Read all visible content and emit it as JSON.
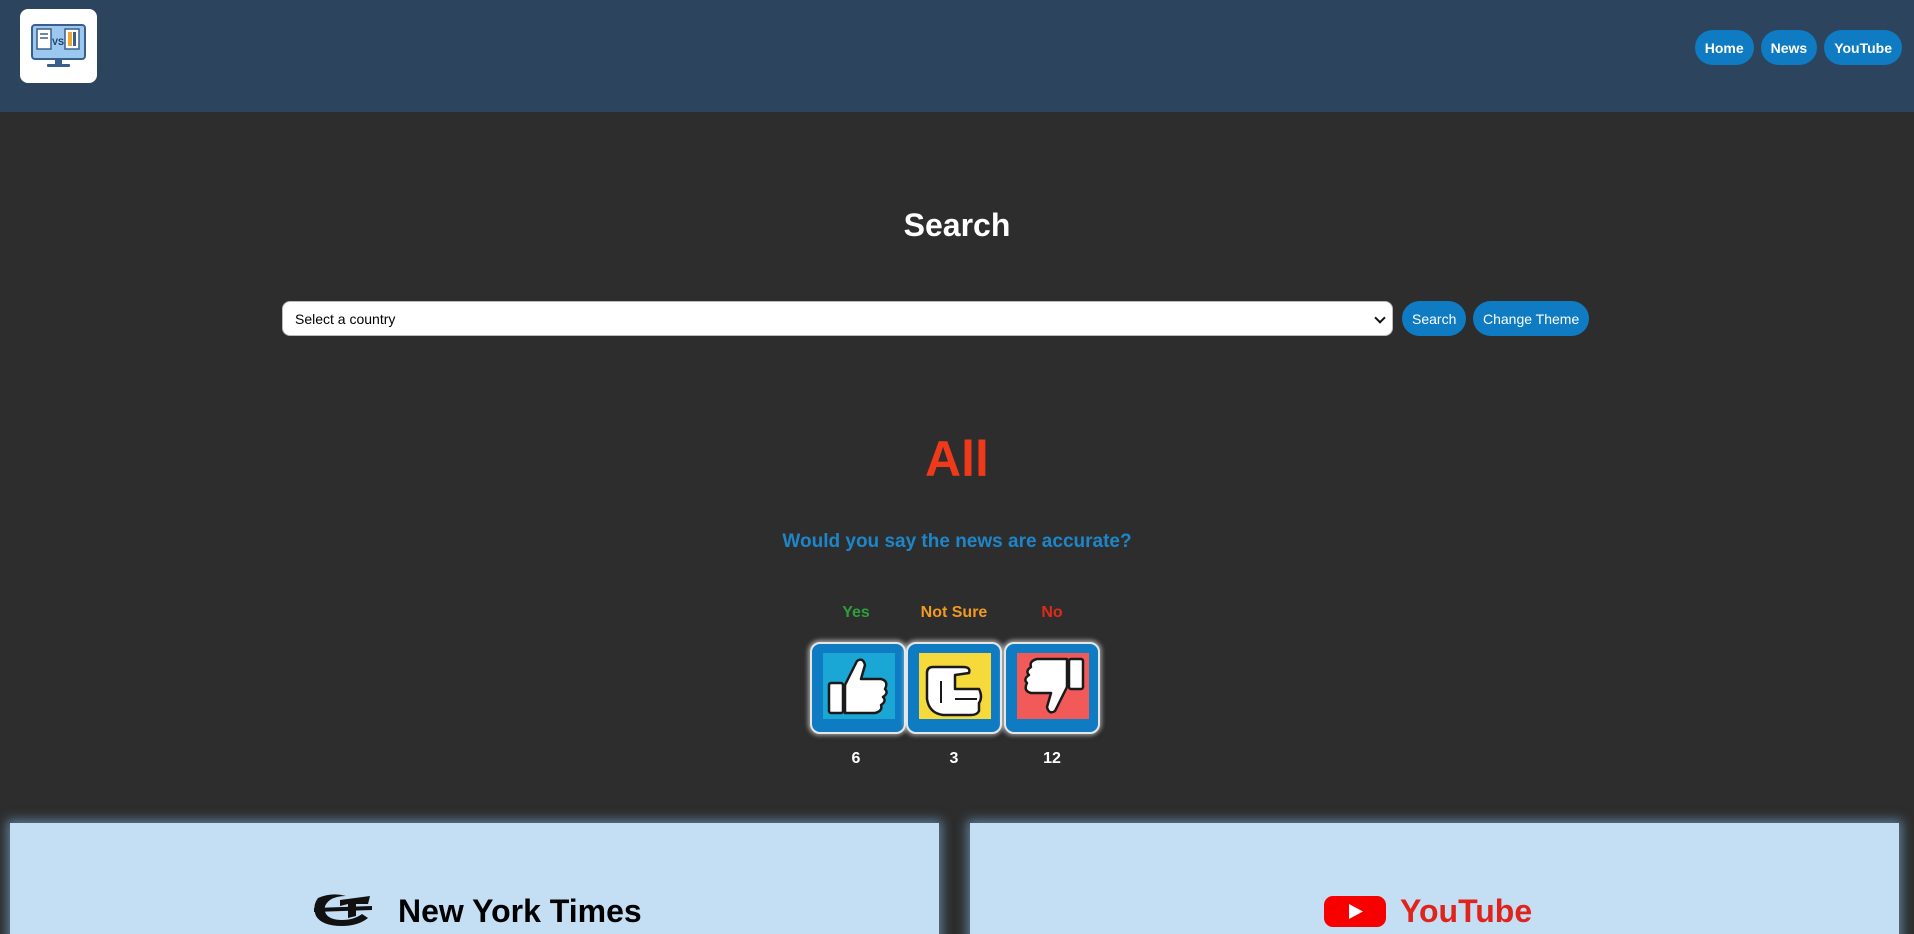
{
  "header": {
    "logo_icon": "monitor-versus-icon",
    "logo_text": "VS",
    "nav": [
      {
        "label": "Home"
      },
      {
        "label": "News"
      },
      {
        "label": "YouTube"
      }
    ]
  },
  "search": {
    "title": "Search",
    "country_select_value": "Select a country",
    "search_button": "Search",
    "theme_button": "Change Theme"
  },
  "poll": {
    "heading": "All",
    "question": "Would you say the news are accurate?",
    "options": [
      {
        "label": "Yes",
        "count": "6",
        "icon": "thumbs-up-icon",
        "color": "#2e9e3a",
        "tile_color": "#1aa7d6"
      },
      {
        "label": "Not Sure",
        "count": "3",
        "icon": "thumbs-sideways-icon",
        "color": "#f19a21",
        "tile_color": "#f6d93a"
      },
      {
        "label": "No",
        "count": "12",
        "icon": "thumbs-down-icon",
        "color": "#e02a1a",
        "tile_color": "#f25a5a"
      }
    ]
  },
  "cards": {
    "news": {
      "title": "New York Times",
      "icon": "nyt-logo-icon"
    },
    "youtube": {
      "title": "YouTube",
      "icon": "youtube-logo-icon",
      "color": "#e0241c"
    }
  }
}
